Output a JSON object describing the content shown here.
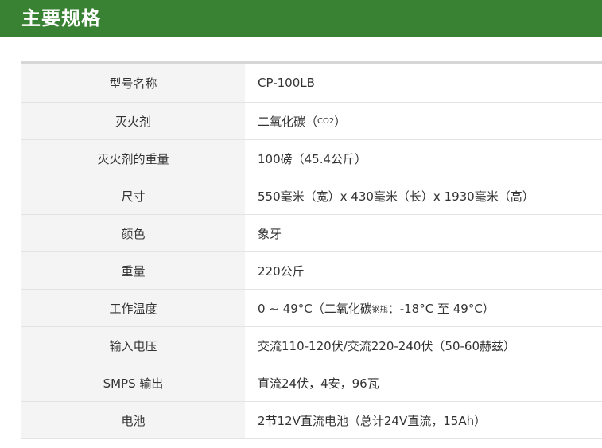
{
  "header": {
    "title": "主要规格"
  },
  "specs": [
    {
      "label": "型号名称",
      "value": "CP-100LB"
    },
    {
      "label": "灭火剂",
      "value_main": "二氧化碳（",
      "value_sub": "CO2",
      "value_end": "）"
    },
    {
      "label": "灭火剂的重量",
      "value": "100磅（45.4公斤）"
    },
    {
      "label": "尺寸",
      "value": "550毫米（宽）x 430毫米（长）x 1930毫米（高）"
    },
    {
      "label": "颜色",
      "value": "象牙"
    },
    {
      "label": "重量",
      "value": "220公斤"
    },
    {
      "label": "工作温度",
      "value_main": "0 ~ 49°C（二氧化碳",
      "value_sub": "钢瓶",
      "value_end": "：-18°C 至 49°C）"
    },
    {
      "label": "输入电压",
      "value": "交流110-120伏/交流220-240伏（50-60赫兹）"
    },
    {
      "label": "SMPS 输出",
      "value": "直流24伏，4安，96瓦"
    },
    {
      "label": "电池",
      "value": "2节12V直流电池（总计24V直流，15Ah）"
    }
  ],
  "colors": {
    "header_bg": "#3a8233",
    "label_bg": "#f4f4f4",
    "border": "#e4e4e4",
    "text": "#333333"
  }
}
